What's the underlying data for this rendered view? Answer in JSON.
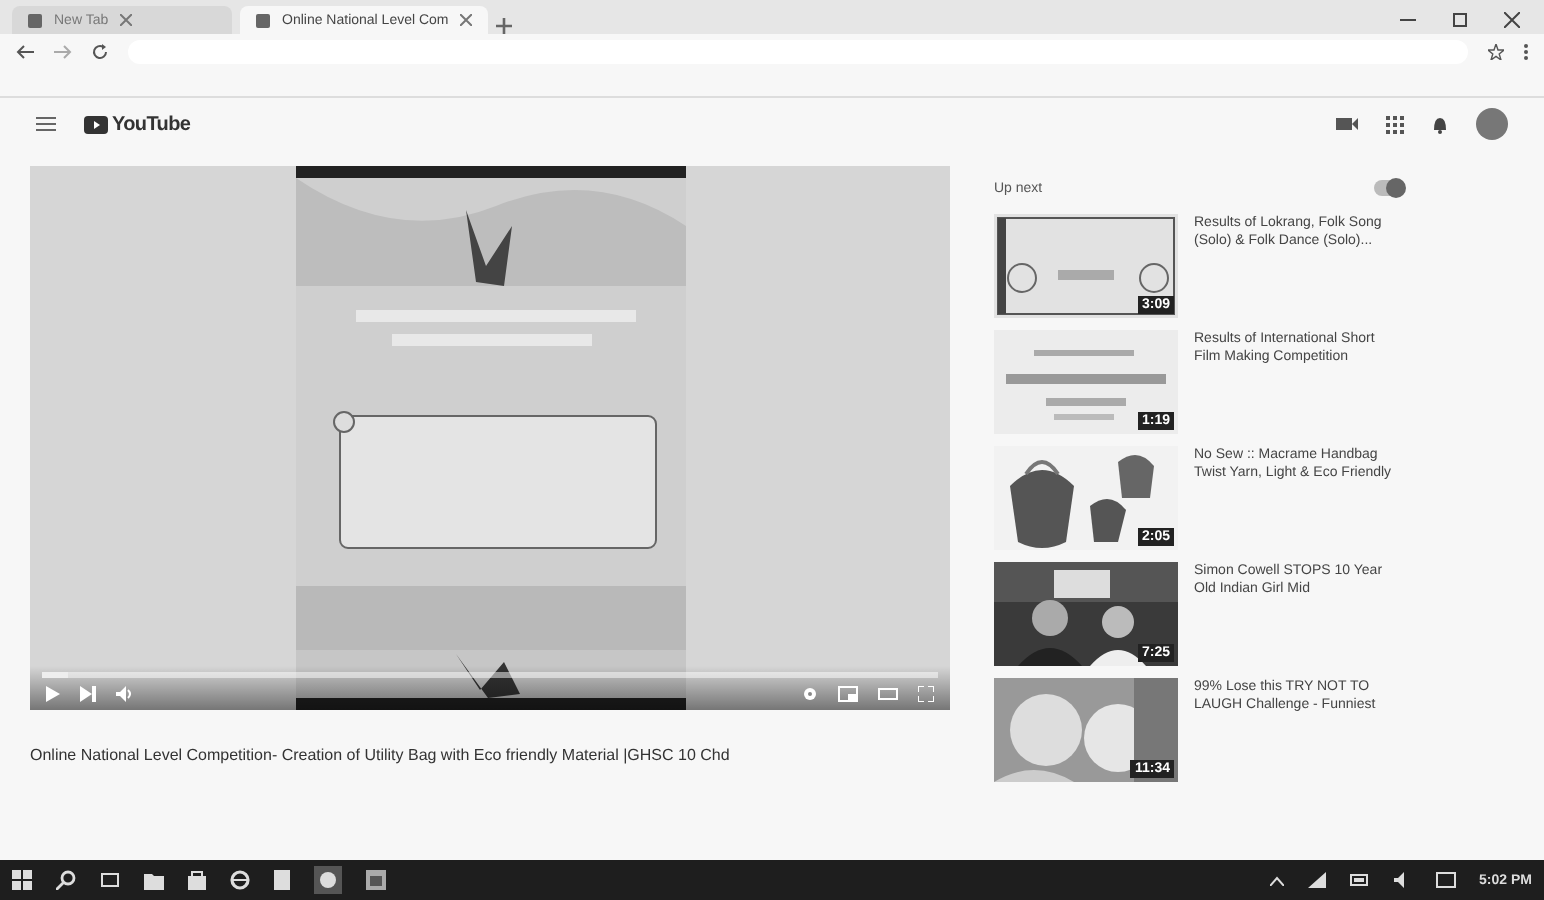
{
  "browser": {
    "tabs": [
      {
        "title": "New Tab",
        "selected": false
      },
      {
        "title": "Online National Level Com",
        "selected": true
      }
    ]
  },
  "youtube": {
    "logo": "YouTube"
  },
  "player": {
    "progress": {
      "level": 0.03
    }
  },
  "video": {
    "title": "Online National Level Competition- Creation of Utility Bag with Eco friendly Material |GHSC 10 Chd"
  },
  "up_next": {
    "label": "Up next",
    "autoplay": {
      "on": true
    }
  },
  "related": [
    {
      "title": "Results of Lokrang, Folk Song (Solo) & Folk Dance (Solo)...",
      "duration": "3:09"
    },
    {
      "title": "Results of International Short Film Making Competition",
      "duration": "1:19"
    },
    {
      "title": "No Sew :: Macrame Handbag Twist Yarn, Light & Eco Friendly",
      "duration": "2:05"
    },
    {
      "title": "Simon Cowell STOPS 10 Year Old Indian Girl Mid",
      "duration": "7:25"
    },
    {
      "title": "99% Lose this TRY NOT TO LAUGH Challenge - Funniest",
      "duration": "11:34"
    }
  ],
  "taskbar": {
    "clock": "5:02 PM"
  }
}
